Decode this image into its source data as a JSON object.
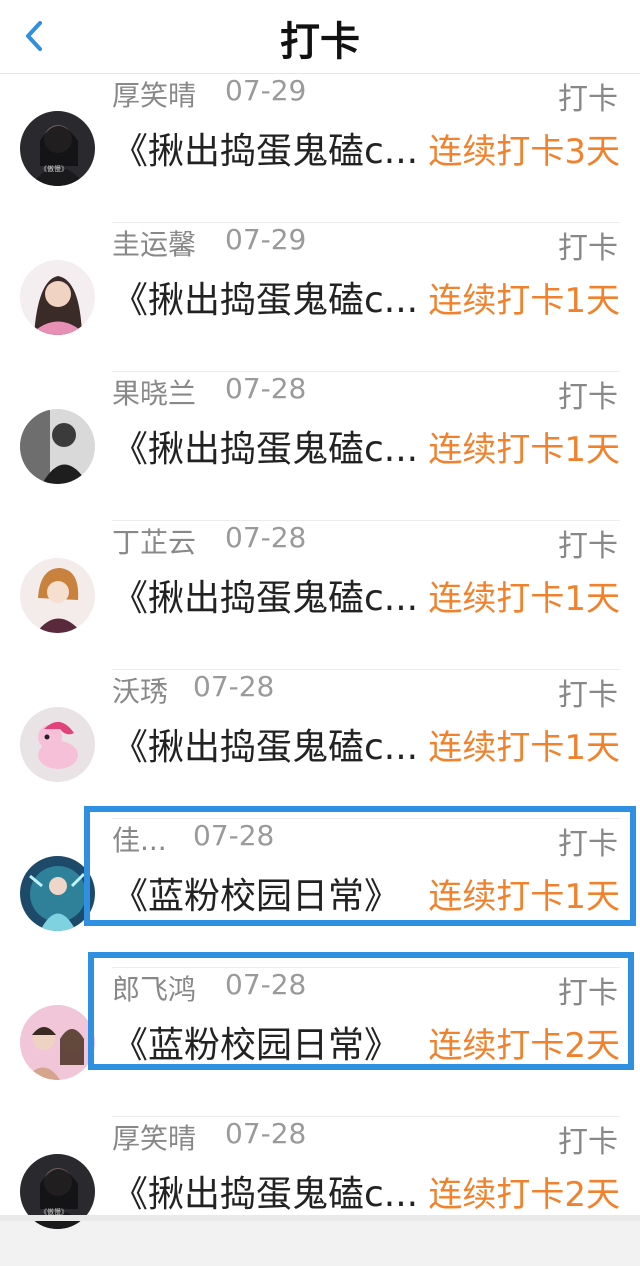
{
  "header": {
    "title": "打卡"
  },
  "colors": {
    "accent_orange": "#f0822d",
    "highlight_blue": "#2f8fe0",
    "back_blue": "#2f8fe0"
  },
  "entries": [
    {
      "name": "厚笑晴",
      "date": "07-29",
      "tag": "打卡",
      "book": "《揪出捣蛋鬼磕c...",
      "streak": "连续打卡3天",
      "avatar_icon": "avatar-girl-dark-icon"
    },
    {
      "name": "圭运馨",
      "date": "07-29",
      "tag": "打卡",
      "book": "《揪出捣蛋鬼磕c...",
      "streak": "连续打卡1天",
      "avatar_icon": "avatar-girl-pink-icon"
    },
    {
      "name": "果晓兰",
      "date": "07-28",
      "tag": "打卡",
      "book": "《揪出捣蛋鬼磕c...",
      "streak": "连续打卡1天",
      "avatar_icon": "avatar-man-bw-icon"
    },
    {
      "name": "丁芷云",
      "date": "07-28",
      "tag": "打卡",
      "book": "《揪出捣蛋鬼磕c...",
      "streak": "连续打卡1天",
      "avatar_icon": "avatar-anime-icon"
    },
    {
      "name": "沃琇",
      "date": "07-28",
      "tag": "打卡",
      "book": "《揪出捣蛋鬼磕c...",
      "streak": "连续打卡1天",
      "avatar_icon": "avatar-unicorn-icon"
    },
    {
      "name": "佳...",
      "date": "07-28",
      "tag": "打卡",
      "book": "《蓝粉校园日常》",
      "streak": "连续打卡1天",
      "avatar_icon": "avatar-fantasy-icon"
    },
    {
      "name": "郎飞鸿",
      "date": "07-28",
      "tag": "打卡",
      "book": "《蓝粉校园日常》",
      "streak": "连续打卡2天",
      "avatar_icon": "avatar-couple-icon"
    },
    {
      "name": "厚笑晴",
      "date": "07-28",
      "tag": "打卡",
      "book": "《揪出捣蛋鬼磕c...",
      "streak": "连续打卡2天",
      "avatar_icon": "avatar-girl-dark-icon"
    }
  ]
}
